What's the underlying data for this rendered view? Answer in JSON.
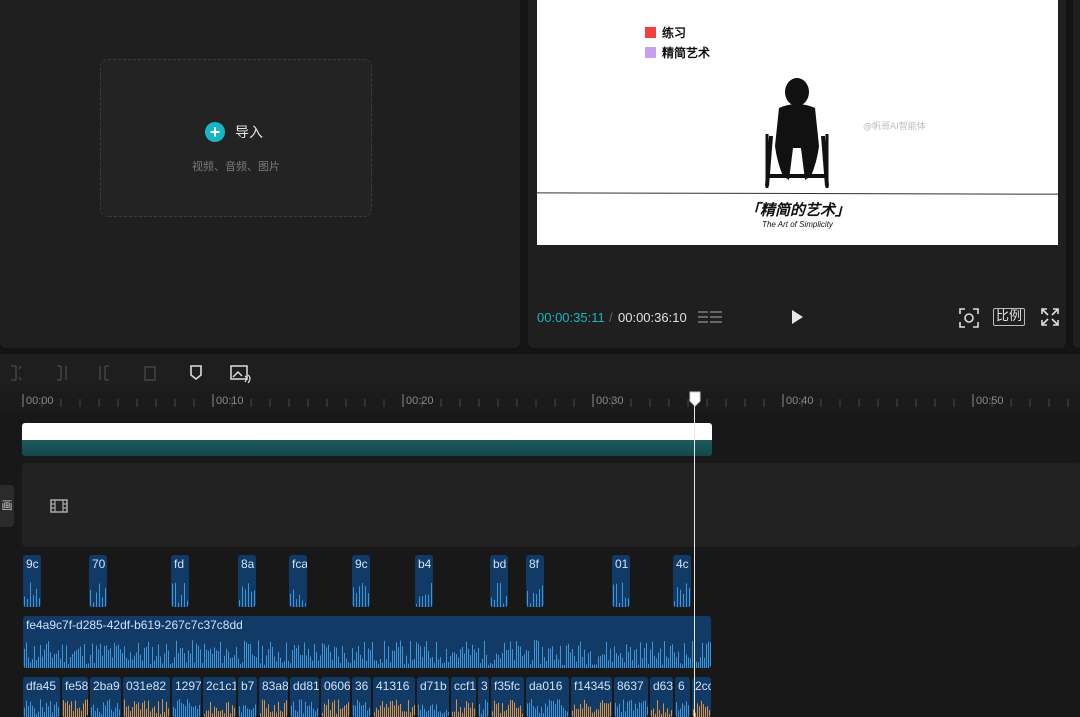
{
  "media_panel": {
    "import_label": "导入",
    "import_hint": "视频、音频、图片"
  },
  "preview": {
    "legend": [
      {
        "label": "练习",
        "color": "#f04040"
      },
      {
        "label": "精简艺术",
        "color": "#c79ef0"
      }
    ],
    "watermark": "@帆哥AI智能体",
    "caption_cn": "「精简的艺术」",
    "caption_en": "The Art of Simplicity"
  },
  "player": {
    "time_current": "00:00:35:11",
    "time_separator": "/",
    "time_total": "00:00:36:10",
    "ratio_label": "比例"
  },
  "timeline": {
    "ruler_ticks": [
      "00:00",
      "00:10",
      "00:20",
      "00:30",
      "00:40",
      "00:50"
    ],
    "side_tab_label": "画",
    "sfx_clips": [
      "9c",
      "70",
      "fd",
      "8a",
      "fca",
      "9c",
      "b4",
      "bd",
      "8f",
      "01",
      "4c"
    ],
    "music_clip": "fe4a9c7f-d285-42df-b619-267c7c37c8dd",
    "voice_clips": [
      "dfa45",
      "fe58",
      "2ba9",
      "031e82",
      "1297",
      "2c1c1",
      "b7",
      "83a8",
      "dd81",
      "0606",
      "36",
      "41316",
      "d71b",
      "ccf1",
      "3",
      "f35fc",
      "da016",
      "f14345",
      "8637",
      "d63",
      "6",
      "2cc"
    ]
  },
  "colors": {
    "accent": "#17b6c4",
    "clip_blue": "#123a66",
    "text_track_teal": "#13484a"
  }
}
